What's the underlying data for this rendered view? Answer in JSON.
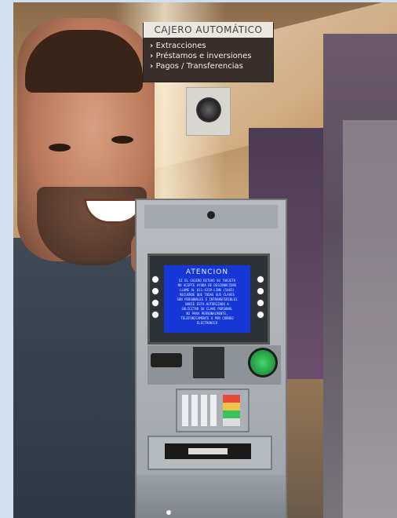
{
  "sign": {
    "title": "CAJERO AUTOMÁTICO",
    "items": [
      "Extracciones",
      "Préstamos e inversiones",
      "Pagos / Transferencias"
    ]
  },
  "atm_screen": {
    "title": "ATENCION",
    "lines": [
      "SI EL CAJERO RETUVO SU TARJETA",
      "NO ACEPTE AYUDA DE DESCONOCIDOS",
      "LLAME AL 011-4319-LINK (5465)",
      "RECUERDE QUE TODAS SUS CLAVES",
      "SON PERSONALES E INTRANSFERIBLES",
      "NADIE ESTA AUTORIZADO A",
      "SOLICITAR SU CLAVE PERSONAL",
      "NI PARA PERSONALMENTE,",
      "TELEFONICAMENTE O POR CORREO",
      "ELECTRONICO"
    ]
  },
  "colors": {
    "screen_bg": "#1437d6",
    "ok_button": "#2ecc55",
    "frame": "#cfe0f3"
  }
}
